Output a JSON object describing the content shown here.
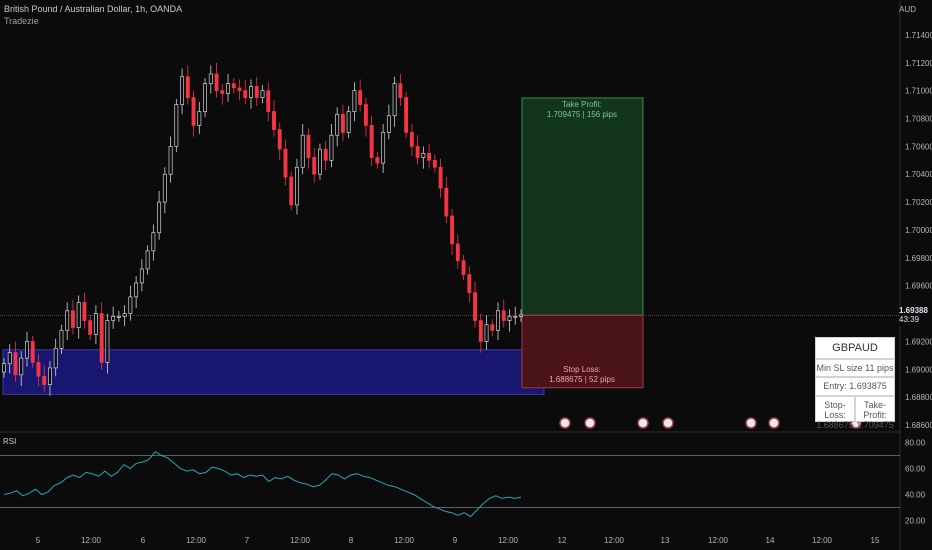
{
  "header": {
    "title": "British Pound / Australian Dollar, 1h, OANDA",
    "indicator": "Tradezie"
  },
  "price_axis": {
    "currency": "AUD",
    "ticks": [
      "1.71400",
      "1.71200",
      "1.71000",
      "1.70800",
      "1.70600",
      "1.70400",
      "1.70200",
      "1.70000",
      "1.69800",
      "1.69600",
      "1.69200",
      "1.69000",
      "1.68800",
      "1.68600"
    ],
    "last_price": "1.69388",
    "countdown": "43:39"
  },
  "rsi": {
    "label": "RSI",
    "ticks": [
      "80.00",
      "60.00",
      "40.00",
      "20.00"
    ],
    "upper_band": 70,
    "lower_band": 30
  },
  "time_axis": {
    "labels": [
      "5",
      "12:00",
      "6",
      "12:00",
      "7",
      "12:00",
      "8",
      "12:00",
      "9",
      "12:00",
      "12",
      "12:00",
      "13",
      "12:00",
      "14",
      "12:00",
      "15"
    ]
  },
  "position": {
    "take_profit_label": "Take Profit:",
    "take_profit_value": "1.709475 | 156 pips",
    "stop_loss_label": "Stop Loss:",
    "stop_loss_value": "1.688675 | 52 pips",
    "entry": 1.693875,
    "take_profit": 1.709475,
    "stop_loss": 1.688675
  },
  "demand_zone": {
    "top": 1.6914,
    "bottom": 1.6882,
    "color": "#1a1775"
  },
  "info_panel": {
    "symbol": "GBPAUD",
    "min_sl": "Min SL size 11 pips",
    "entry": "Entry: 1.693875",
    "stop_loss_label": "Stop-Loss:",
    "stop_loss_value": "1.688675",
    "take_profit_label": "Take-Profit:",
    "take_profit_value": "1.709475"
  },
  "colors": {
    "up": "#d1d4dc",
    "down": "#f23645",
    "rsi_line": "#2fa3b8",
    "tp_zone": "#12351c",
    "sl_zone": "#4a1318"
  },
  "chart_data": {
    "type": "candlestick",
    "ylabel": "AUD",
    "ylim": [
      1.6855,
      1.7155
    ],
    "close": [
      1.6904,
      1.6912,
      1.6896,
      1.6908,
      1.692,
      1.6905,
      1.6895,
      1.6889,
      1.6901,
      1.6915,
      1.6928,
      1.6942,
      1.693,
      1.6948,
      1.6935,
      1.6925,
      1.694,
      1.6905,
      1.6935,
      1.6938,
      1.6938,
      1.694,
      1.6952,
      1.6962,
      1.6972,
      1.6985,
      1.6998,
      1.702,
      1.704,
      1.706,
      1.709,
      1.711,
      1.7095,
      1.7075,
      1.7085,
      1.7105,
      1.7112,
      1.71,
      1.7098,
      1.7105,
      1.7102,
      1.71,
      1.7095,
      1.7103,
      1.7095,
      1.71,
      1.7085,
      1.7072,
      1.7058,
      1.7038,
      1.7018,
      1.7045,
      1.7068,
      1.7052,
      1.704,
      1.7058,
      1.705,
      1.7068,
      1.7083,
      1.707,
      1.7085,
      1.71,
      1.709,
      1.7075,
      1.7052,
      1.7048,
      1.707,
      1.7082,
      1.7105,
      1.7095,
      1.707,
      1.706,
      1.7052,
      1.7055,
      1.705,
      1.7045,
      1.703,
      1.701,
      1.699,
      1.6978,
      1.6968,
      1.6955,
      1.6935,
      1.692,
      1.6932,
      1.6928,
      1.6942,
      1.6935,
      1.6938,
      1.6938,
      1.6939
    ],
    "rsi": [
      40,
      41,
      43,
      39,
      41,
      44,
      40,
      42,
      47,
      49,
      53,
      55,
      53,
      57,
      56,
      54,
      58,
      54,
      57,
      63,
      60,
      64,
      65,
      67,
      73,
      70,
      68,
      64,
      60,
      58,
      59,
      56,
      57,
      61,
      60,
      58,
      55,
      56,
      53,
      55,
      54,
      55,
      50,
      53,
      52,
      54,
      51,
      49,
      48,
      46,
      47,
      51,
      56,
      55,
      52,
      55,
      56,
      54,
      53,
      51,
      49,
      47,
      46,
      44,
      42,
      40,
      37,
      34,
      31,
      29,
      27,
      26,
      24,
      26,
      23,
      28,
      33,
      37,
      39,
      37,
      38,
      37,
      38
    ],
    "time_labels": [
      "5",
      "12:00",
      "6",
      "12:00",
      "7",
      "12:00",
      "8",
      "12:00",
      "9",
      "12:00",
      "12",
      "12:00",
      "13",
      "12:00",
      "14",
      "12:00",
      "15"
    ]
  }
}
